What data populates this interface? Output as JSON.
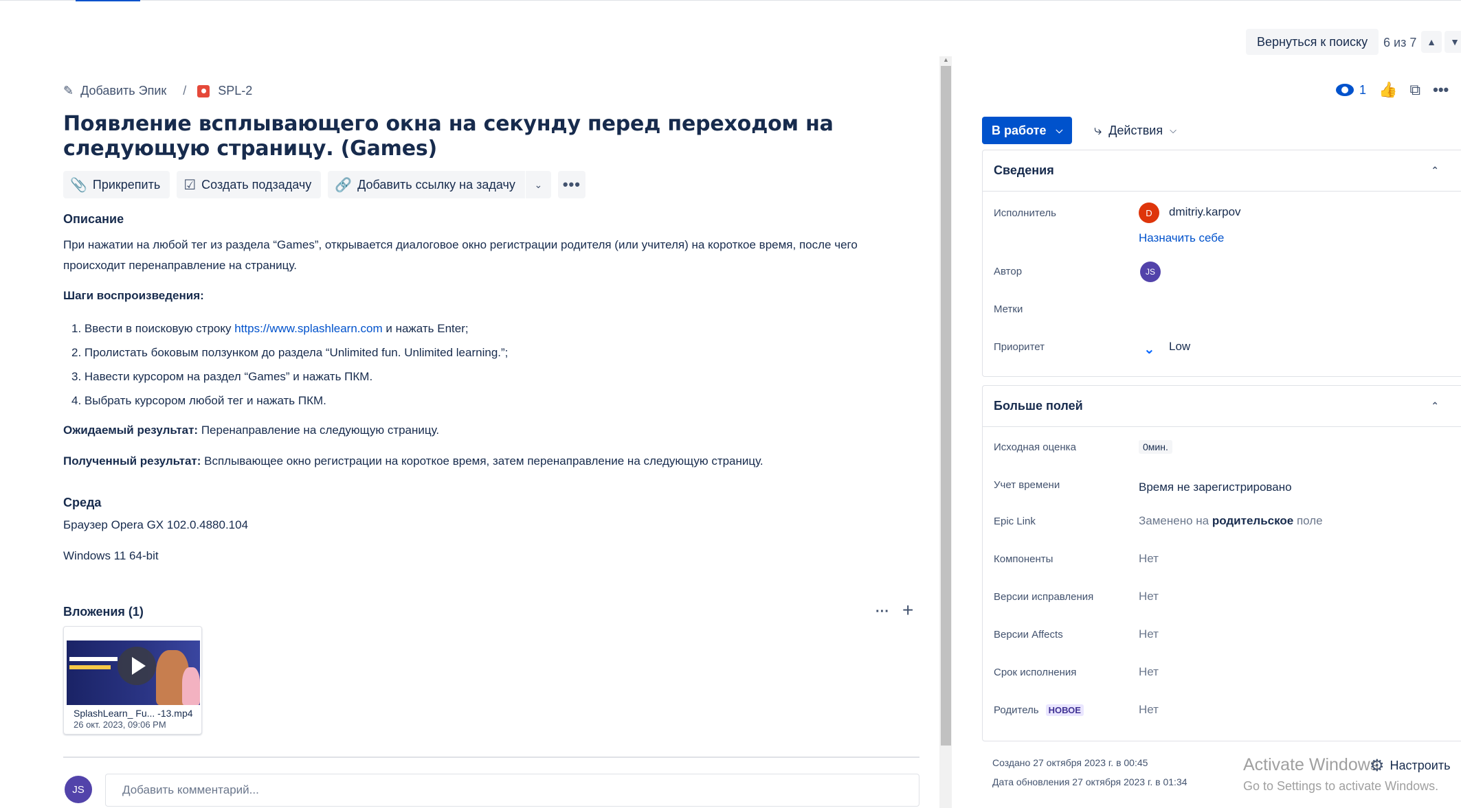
{
  "nav": {
    "back_label": "Вернуться к поиску",
    "pager": "6 из 7"
  },
  "breadcrumb": {
    "add_epic": "Добавить Эпик",
    "separator": "/",
    "issue_key": "SPL-2"
  },
  "issue": {
    "title": "Появление всплывающего окна на секунду перед переходом на следующую страницу. (Games)"
  },
  "toolbar": {
    "attach": "Прикрепить",
    "create_subtask": "Создать подзадачу",
    "add_link": "Добавить ссылку на задачу"
  },
  "description": {
    "heading": "Описание",
    "text_line1": "При нажатии на любой тег из раздела “Games”, открывается диалоговое окно регистрации родителя (или учителя) на короткое время, после чего",
    "text_line2": "происходит перенаправление на страницу.",
    "steps_heading": "Шаги воспроизведения:",
    "step1_pre": "1. Ввести в поисковую строку ",
    "step1_link": "https://www.splashlearn.com",
    "step1_post": " и нажать Enter;",
    "step2": "2. Пролистать боковым ползунком до раздела “Unlimited fun. Unlimited learning.”;",
    "step3": "3. Навести курсором на раздел “Games” и нажать ПКМ.",
    "step4": "4. Выбрать курсором любой тег и нажать ПКМ.",
    "expected_label": "Ожидаемый результат:",
    "expected_text": " Перенаправление на следующую страницу.",
    "actual_label": "Полученный результат:",
    "actual_text": " Всплывающее окно регистрации на короткое время, затем перенаправление на следующую страницу."
  },
  "environment": {
    "heading": "Среда",
    "browser": "Браузер Opera GX 102.0.4880.104",
    "os": "Windows 11 64-bit"
  },
  "attachments": {
    "heading": "Вложения (1)",
    "file_name": "SplashLearn_ Fu... -13.mp4",
    "file_date": "26 окт. 2023, 09:06 PM"
  },
  "comment": {
    "avatar": "JS",
    "placeholder": "Добавить комментарий..."
  },
  "header_right": {
    "watchers": "1"
  },
  "status": {
    "label": "В работе",
    "actions": "Действия"
  },
  "details": {
    "heading": "Сведения",
    "assignee_label": "Исполнитель",
    "assignee_avatar": "D",
    "assignee_name": "dmitriy.karpov",
    "assign_to_me": "Назначить себе",
    "reporter_label": "Автор",
    "reporter_avatar": "JS",
    "labels_label": "Метки",
    "priority_label": "Приоритет",
    "priority_value": "Low"
  },
  "more_fields": {
    "heading": "Больше полей",
    "estimate_label": "Исходная оценка",
    "estimate_value": "0мин.",
    "time_label": "Учет времени",
    "time_value": "Время не зарегистрировано",
    "epic_label": "Epic Link",
    "epic_pre": "Заменено на ",
    "epic_bold": "родительское",
    "epic_post": " поле",
    "components_label": "Компоненты",
    "components_value": "Нет",
    "fix_label": "Версии исправления",
    "fix_value": "Нет",
    "affects_label": "Версии Affects",
    "affects_value": "Нет",
    "due_label": "Срок исполнения",
    "due_value": "Нет",
    "parent_label": "Родитель",
    "parent_badge": "НОВОЕ",
    "parent_value": "Нет"
  },
  "meta": {
    "created": "Создано 27 октября 2023 г. в 00:45",
    "updated": "Дата обновления 27 октября 2023 г. в 01:34",
    "configure": "Настроить"
  },
  "watermark": {
    "line1": "Activate Windows",
    "line2": "Go to Settings to activate Windows."
  },
  "colors": {
    "primary": "#0052cc",
    "text": "#172b4d",
    "muted": "#42526e",
    "bug": "#e5493a",
    "assignee_avatar": "#de350b",
    "reporter_avatar": "#5243aa"
  }
}
